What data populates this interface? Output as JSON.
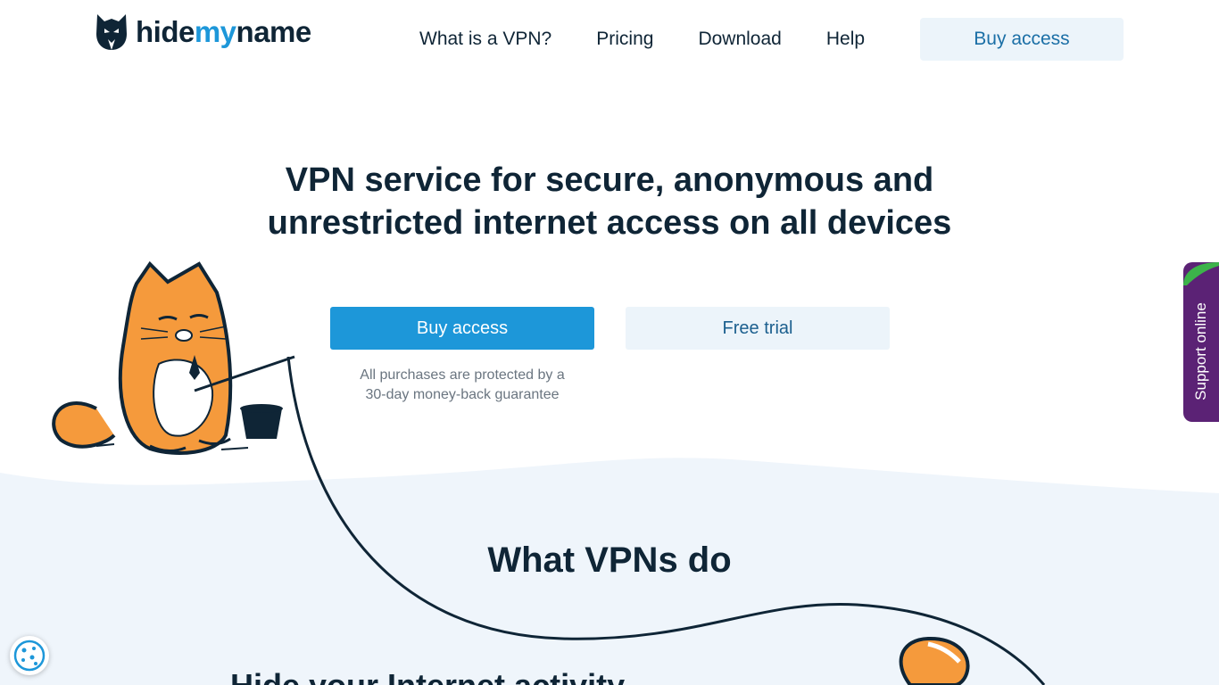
{
  "header": {
    "logo": {
      "part1": "hide",
      "part2": "my",
      "part3": "name"
    },
    "menu": [
      "What is a VPN?",
      "Pricing",
      "Download",
      "Help"
    ],
    "buy_label": "Buy access"
  },
  "hero": {
    "title_line1": "VPN service for secure, anonymous and",
    "title_line2": "unrestricted internet access on all devices",
    "buy_label": "Buy access",
    "trial_label": "Free trial",
    "guarantee_line1": "All purchases are protected by a",
    "guarantee_line2": "30-day money-back guarantee"
  },
  "section": {
    "title": "What VPNs do",
    "subtitle": "Hide your Internet activity"
  },
  "support": {
    "label": "Support online"
  },
  "icons": {
    "logo": "cat-mask-logo-icon",
    "cookie": "cookie-icon",
    "mascot": "orange-cat-fishing-illustration"
  },
  "colors": {
    "accent": "#1d97d9",
    "dark_text": "#0f2536",
    "light_bg": "#ecf4fa",
    "support_bg": "#5b2275",
    "mascot_orange": "#f59a3c"
  }
}
